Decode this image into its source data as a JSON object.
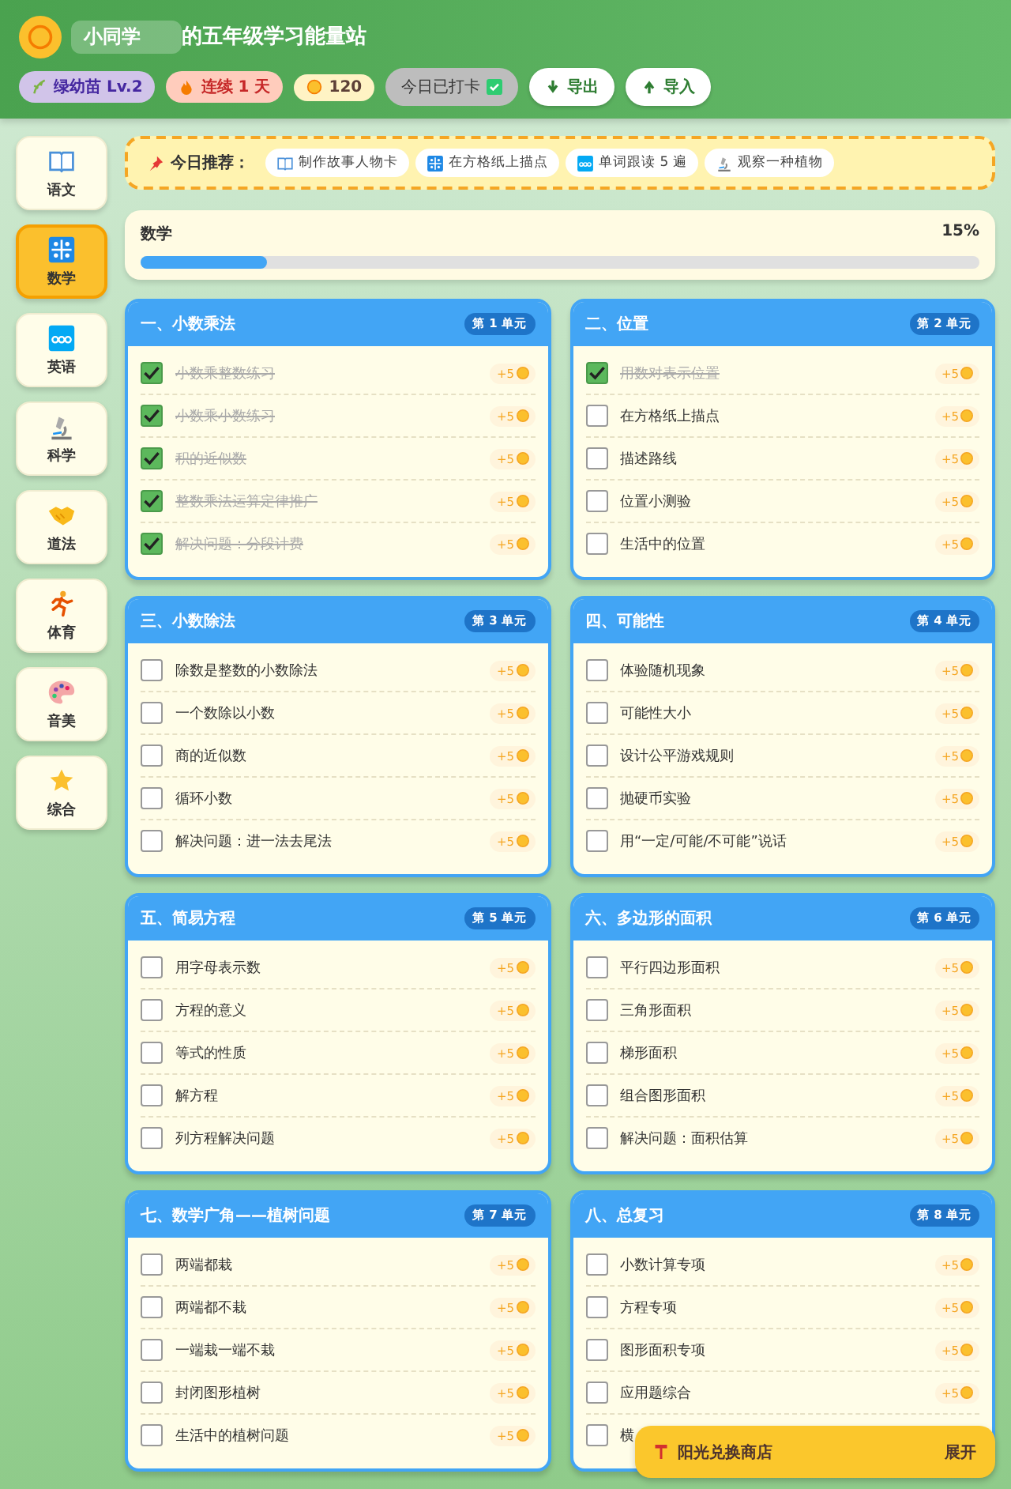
{
  "header": {
    "name_prefix": "小同学",
    "title": "的五年级学习能量站",
    "badges": [
      {
        "kind": "level",
        "label": "绿幼苗 Lv.2"
      },
      {
        "kind": "streak",
        "label": "连续 1 天"
      },
      {
        "kind": "coins",
        "label": "120"
      }
    ],
    "checkin": {
      "label": "今日已打卡",
      "checked": true
    },
    "buttons": [
      {
        "kind": "export",
        "label": "导出"
      },
      {
        "kind": "import",
        "label": "导入"
      }
    ]
  },
  "sidebar": {
    "items": [
      {
        "kind": "book",
        "label": "语文",
        "selected": false
      },
      {
        "kind": "numbers",
        "label": "数学",
        "selected": true
      },
      {
        "kind": "abc",
        "label": "英语",
        "selected": false
      },
      {
        "kind": "microscope",
        "label": "科学",
        "selected": false
      },
      {
        "kind": "handshake",
        "label": "道法",
        "selected": false
      },
      {
        "kind": "runner",
        "label": "体育",
        "selected": false
      },
      {
        "kind": "palette",
        "label": "音美",
        "selected": false
      },
      {
        "kind": "star",
        "label": "综合",
        "selected": false
      }
    ]
  },
  "recommend": {
    "label": "今日推荐：",
    "items": [
      {
        "kind": "book",
        "label": "制作故事人物卡"
      },
      {
        "kind": "numbers",
        "label": "在方格纸上描点"
      },
      {
        "kind": "abc",
        "label": "单词跟读 5 遍"
      },
      {
        "kind": "microscope",
        "label": "观察一种植物"
      }
    ]
  },
  "progress": {
    "subject": "数学",
    "percent": "15%",
    "level": 0.15
  },
  "units": [
    {
      "title": "一、小数乘法",
      "unit": "第 1 单元",
      "tasks": [
        {
          "label": "小数乘整数练习",
          "reward": "+5",
          "checked": true
        },
        {
          "label": "小数乘小数练习",
          "reward": "+5",
          "checked": true
        },
        {
          "label": "积的近似数",
          "reward": "+5",
          "checked": true
        },
        {
          "label": "整数乘法运算定律推广",
          "reward": "+5",
          "checked": true
        },
        {
          "label": "解决问题：分段计费",
          "reward": "+5",
          "checked": true
        }
      ]
    },
    {
      "title": "二、位置",
      "unit": "第 2 单元",
      "tasks": [
        {
          "label": "用数对表示位置",
          "reward": "+5",
          "checked": true
        },
        {
          "label": "在方格纸上描点",
          "reward": "+5",
          "checked": false
        },
        {
          "label": "描述路线",
          "reward": "+5",
          "checked": false
        },
        {
          "label": "位置小测验",
          "reward": "+5",
          "checked": false
        },
        {
          "label": "生活中的位置",
          "reward": "+5",
          "checked": false
        }
      ]
    },
    {
      "title": "三、小数除法",
      "unit": "第 3 单元",
      "tasks": [
        {
          "label": "除数是整数的小数除法",
          "reward": "+5",
          "checked": false
        },
        {
          "label": "一个数除以小数",
          "reward": "+5",
          "checked": false
        },
        {
          "label": "商的近似数",
          "reward": "+5",
          "checked": false
        },
        {
          "label": "循环小数",
          "reward": "+5",
          "checked": false
        },
        {
          "label": "解决问题：进一法去尾法",
          "reward": "+5",
          "checked": false
        }
      ]
    },
    {
      "title": "四、可能性",
      "unit": "第 4 单元",
      "tasks": [
        {
          "label": "体验随机现象",
          "reward": "+5",
          "checked": false
        },
        {
          "label": "可能性大小",
          "reward": "+5",
          "checked": false
        },
        {
          "label": "设计公平游戏规则",
          "reward": "+5",
          "checked": false
        },
        {
          "label": "抛硬币实验",
          "reward": "+5",
          "checked": false
        },
        {
          "label": "用“一定/可能/不可能”说话",
          "reward": "+5",
          "checked": false
        }
      ]
    },
    {
      "title": "五、简易方程",
      "unit": "第 5 单元",
      "tasks": [
        {
          "label": "用字母表示数",
          "reward": "+5",
          "checked": false
        },
        {
          "label": "方程的意义",
          "reward": "+5",
          "checked": false
        },
        {
          "label": "等式的性质",
          "reward": "+5",
          "checked": false
        },
        {
          "label": "解方程",
          "reward": "+5",
          "checked": false
        },
        {
          "label": "列方程解决问题",
          "reward": "+5",
          "checked": false
        }
      ]
    },
    {
      "title": "六、多边形的面积",
      "unit": "第 6 单元",
      "tasks": [
        {
          "label": "平行四边形面积",
          "reward": "+5",
          "checked": false
        },
        {
          "label": "三角形面积",
          "reward": "+5",
          "checked": false
        },
        {
          "label": "梯形面积",
          "reward": "+5",
          "checked": false
        },
        {
          "label": "组合图形面积",
          "reward": "+5",
          "checked": false
        },
        {
          "label": "解决问题：面积估算",
          "reward": "+5",
          "checked": false
        }
      ]
    },
    {
      "title": "七、数学广角——植树问题",
      "unit": "第 7 单元",
      "tasks": [
        {
          "label": "两端都栽",
          "reward": "+5",
          "checked": false
        },
        {
          "label": "两端都不栽",
          "reward": "+5",
          "checked": false
        },
        {
          "label": "一端栽一端不栽",
          "reward": "+5",
          "checked": false
        },
        {
          "label": "封闭图形植树",
          "reward": "+5",
          "checked": false
        },
        {
          "label": "生活中的植树问题",
          "reward": "+5",
          "checked": false
        }
      ]
    },
    {
      "title": "八、总复习",
      "unit": "第 8 单元",
      "tasks": [
        {
          "label": "小数计算专项",
          "reward": "+5",
          "checked": false
        },
        {
          "label": "方程专项",
          "reward": "+5",
          "checked": false
        },
        {
          "label": "图形面积专项",
          "reward": "+5",
          "checked": false
        },
        {
          "label": "应用题综合",
          "reward": "+5",
          "checked": false
        },
        {
          "label": "横",
          "checked": false
        }
      ]
    }
  ],
  "shop": {
    "label": "阳光兑换商店",
    "toggle": "展开"
  }
}
